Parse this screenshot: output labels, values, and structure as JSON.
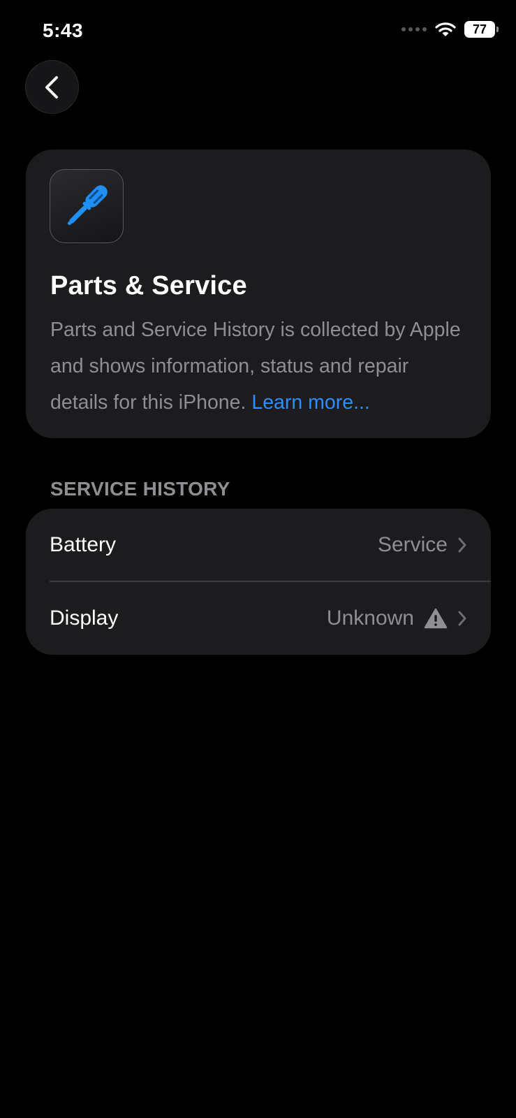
{
  "status_bar": {
    "time": "5:43",
    "battery_level": "77"
  },
  "navigation": {
    "back_icon": "chevron-left-icon"
  },
  "info_card": {
    "icon": "screwdriver-icon",
    "title": "Parts & Service",
    "description": "Parts and Service History is collected by Apple and shows information, status and repair details for this iPhone.",
    "learn_more": "Learn more..."
  },
  "service_history": {
    "header": "SERVICE HISTORY",
    "items": [
      {
        "label": "Battery",
        "value": "Service",
        "warning": false
      },
      {
        "label": "Display",
        "value": "Unknown",
        "warning": true
      }
    ]
  },
  "colors": {
    "background": "#000000",
    "card": "#1c1c1e",
    "secondary_text": "#8e8e93",
    "link": "#2f8dff",
    "icon_accent": "#1f8ff5"
  }
}
